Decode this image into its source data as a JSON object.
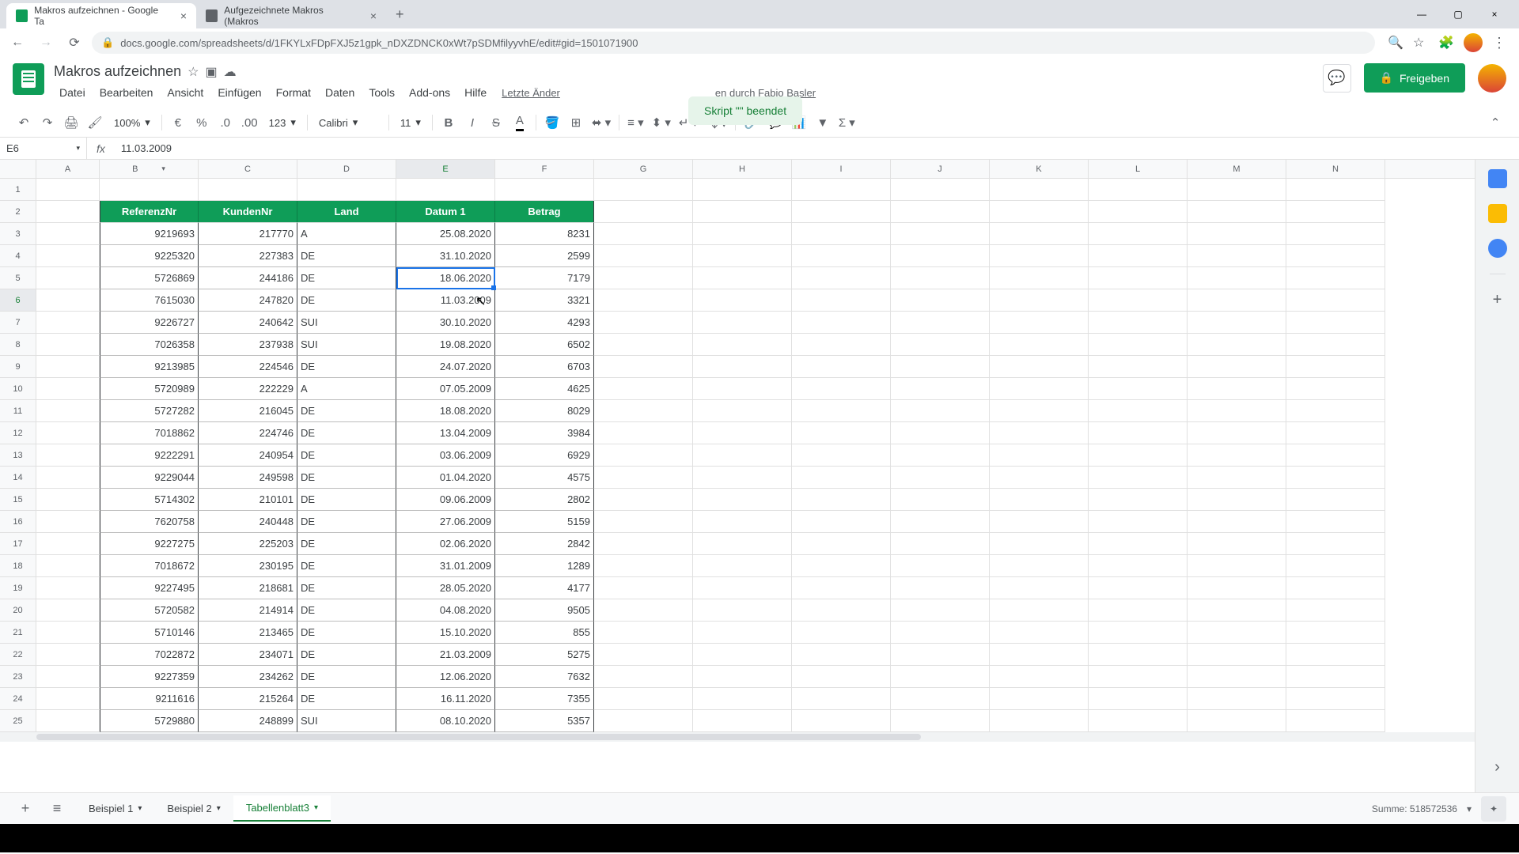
{
  "browser": {
    "tabs": [
      {
        "title": "Makros aufzeichnen - Google Ta"
      },
      {
        "title": "Aufgezeichnete Makros (Makros"
      }
    ],
    "url": "docs.google.com/spreadsheets/d/1FKYLxFDpFXJ5z1gpk_nDXZDNCK0xWt7pSDMfilyyvhE/edit#gid=1501071900"
  },
  "doc": {
    "title": "Makros aufzeichnen",
    "menus": [
      "Datei",
      "Bearbeiten",
      "Ansicht",
      "Einfügen",
      "Format",
      "Daten",
      "Tools",
      "Add-ons",
      "Hilfe"
    ],
    "status_prefix": "Letzte Änder",
    "status_suffix": "en durch Fabio Basler",
    "toast": "Skript \"\" beendet",
    "share": "Freigeben"
  },
  "toolbar": {
    "zoom": "100%",
    "format_num": "123",
    "font": "Calibri",
    "font_size": "11"
  },
  "formula": {
    "name_box": "E6",
    "value": "11.03.2009"
  },
  "columns": [
    "A",
    "B",
    "C",
    "D",
    "E",
    "F",
    "G",
    "H",
    "I",
    "J",
    "K",
    "L",
    "M",
    "N"
  ],
  "table": {
    "headers": [
      "ReferenzNr",
      "KundenNr",
      "Land",
      "Datum 1",
      "Betrag"
    ],
    "rows": [
      {
        "ref": "9219693",
        "kunde": "217770",
        "land": "A",
        "datum": "25.08.2020",
        "betrag": "8231"
      },
      {
        "ref": "9225320",
        "kunde": "227383",
        "land": "DE",
        "datum": "31.10.2020",
        "betrag": "2599"
      },
      {
        "ref": "5726869",
        "kunde": "244186",
        "land": "DE",
        "datum": "18.06.2020",
        "betrag": "7179"
      },
      {
        "ref": "7615030",
        "kunde": "247820",
        "land": "DE",
        "datum": "11.03.2009",
        "betrag": "3321"
      },
      {
        "ref": "9226727",
        "kunde": "240642",
        "land": "SUI",
        "datum": "30.10.2020",
        "betrag": "4293"
      },
      {
        "ref": "7026358",
        "kunde": "237938",
        "land": "SUI",
        "datum": "19.08.2020",
        "betrag": "6502"
      },
      {
        "ref": "9213985",
        "kunde": "224546",
        "land": "DE",
        "datum": "24.07.2020",
        "betrag": "6703"
      },
      {
        "ref": "5720989",
        "kunde": "222229",
        "land": "A",
        "datum": "07.05.2009",
        "betrag": "4625"
      },
      {
        "ref": "5727282",
        "kunde": "216045",
        "land": "DE",
        "datum": "18.08.2020",
        "betrag": "8029"
      },
      {
        "ref": "7018862",
        "kunde": "224746",
        "land": "DE",
        "datum": "13.04.2009",
        "betrag": "3984"
      },
      {
        "ref": "9222291",
        "kunde": "240954",
        "land": "DE",
        "datum": "03.06.2009",
        "betrag": "6929"
      },
      {
        "ref": "9229044",
        "kunde": "249598",
        "land": "DE",
        "datum": "01.04.2020",
        "betrag": "4575"
      },
      {
        "ref": "5714302",
        "kunde": "210101",
        "land": "DE",
        "datum": "09.06.2009",
        "betrag": "2802"
      },
      {
        "ref": "7620758",
        "kunde": "240448",
        "land": "DE",
        "datum": "27.06.2009",
        "betrag": "5159"
      },
      {
        "ref": "9227275",
        "kunde": "225203",
        "land": "DE",
        "datum": "02.06.2020",
        "betrag": "2842"
      },
      {
        "ref": "7018672",
        "kunde": "230195",
        "land": "DE",
        "datum": "31.01.2009",
        "betrag": "1289"
      },
      {
        "ref": "9227495",
        "kunde": "218681",
        "land": "DE",
        "datum": "28.05.2020",
        "betrag": "4177"
      },
      {
        "ref": "5720582",
        "kunde": "214914",
        "land": "DE",
        "datum": "04.08.2020",
        "betrag": "9505"
      },
      {
        "ref": "5710146",
        "kunde": "213465",
        "land": "DE",
        "datum": "15.10.2020",
        "betrag": "855"
      },
      {
        "ref": "7022872",
        "kunde": "234071",
        "land": "DE",
        "datum": "21.03.2009",
        "betrag": "5275"
      },
      {
        "ref": "9227359",
        "kunde": "234262",
        "land": "DE",
        "datum": "12.06.2020",
        "betrag": "7632"
      },
      {
        "ref": "9211616",
        "kunde": "215264",
        "land": "DE",
        "datum": "16.11.2020",
        "betrag": "7355"
      },
      {
        "ref": "5729880",
        "kunde": "248899",
        "land": "SUI",
        "datum": "08.10.2020",
        "betrag": "5357"
      }
    ]
  },
  "sheets": {
    "tabs": [
      "Beispiel 1",
      "Beispiel 2",
      "Tabellenblatt3"
    ],
    "active": 2,
    "status": "Summe: 518572536"
  }
}
